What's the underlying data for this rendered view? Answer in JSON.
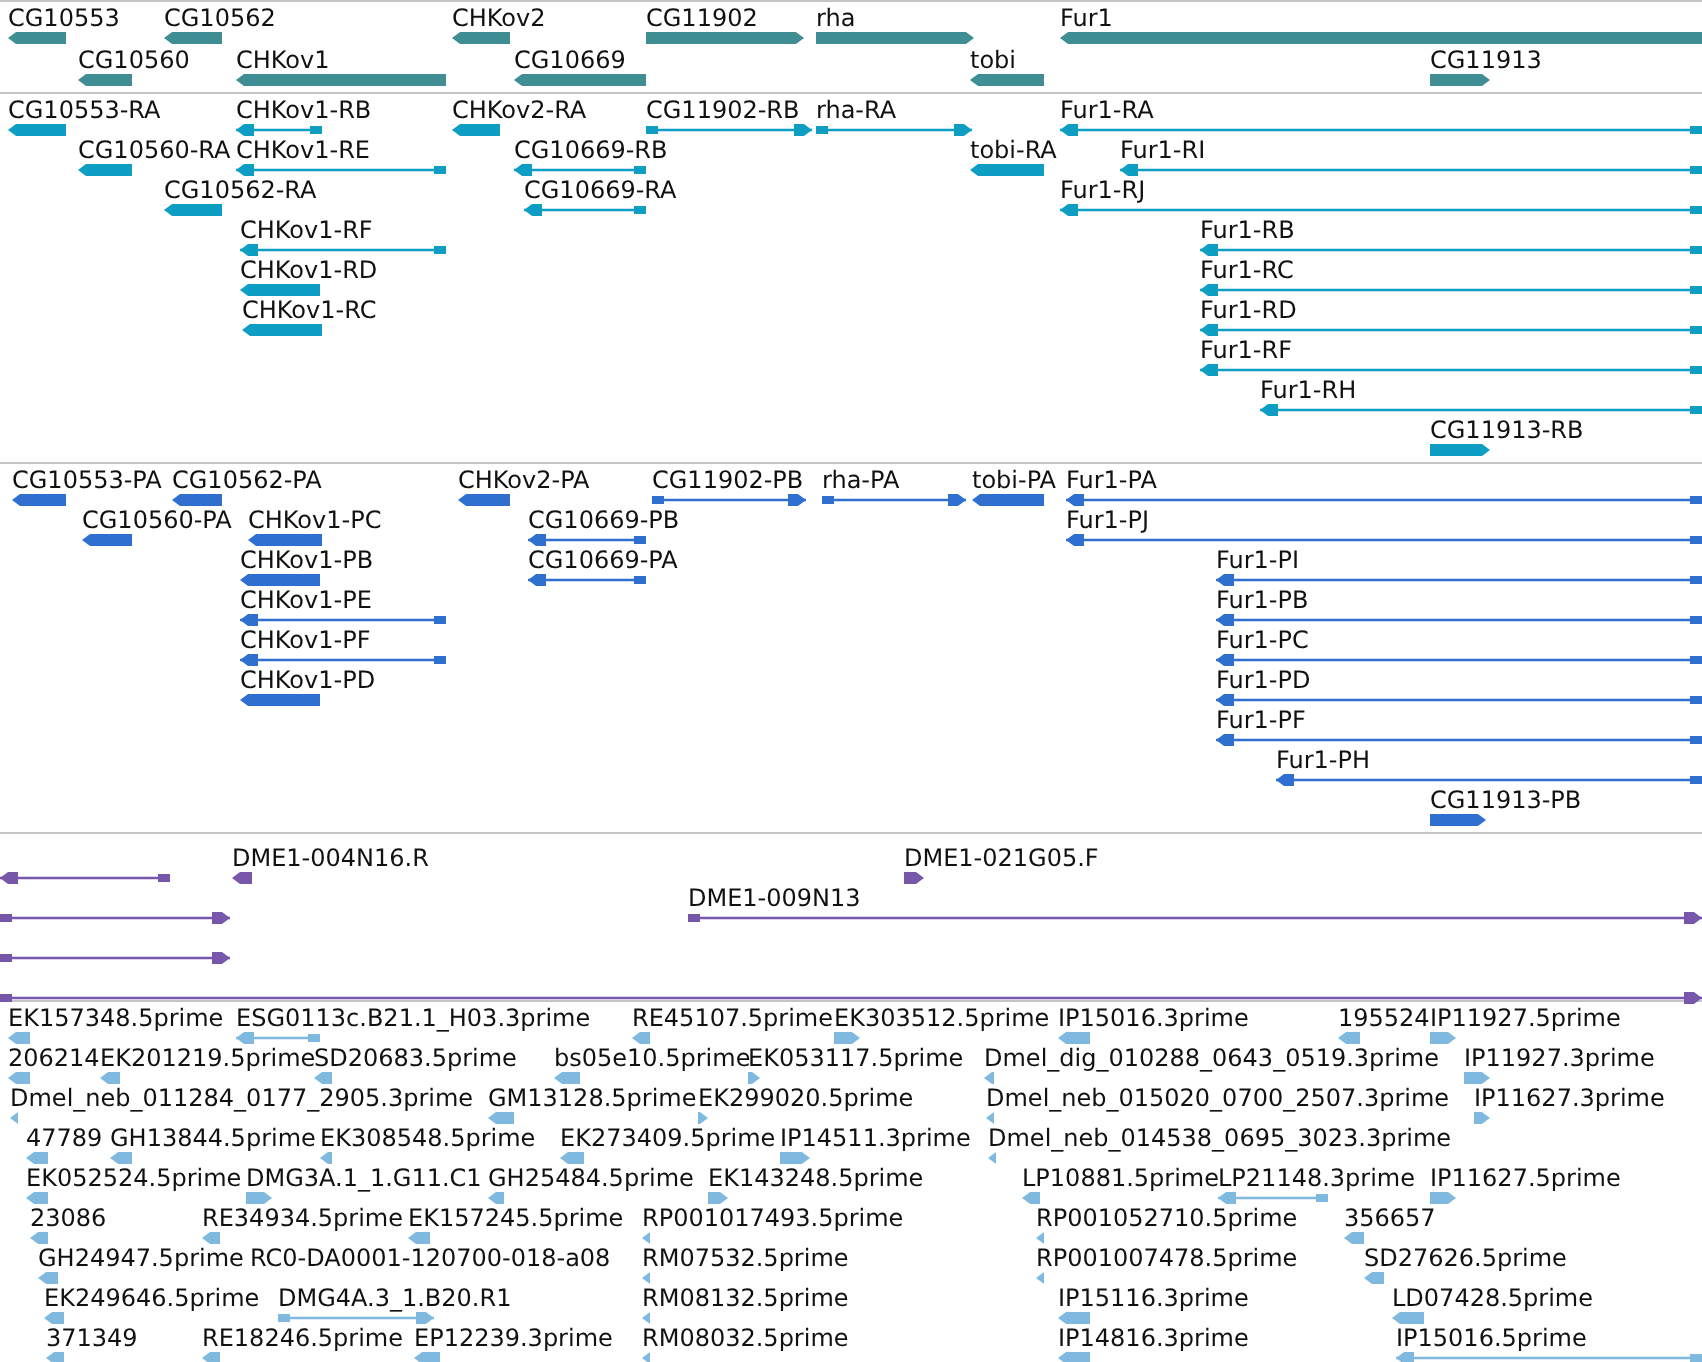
{
  "tracks": [
    {
      "kind": "gene",
      "features": [
        {
          "label": "CG10553",
          "reverse": true
        },
        {
          "label": "CG10562",
          "reverse": true
        },
        {
          "label": "CHKov2",
          "reverse": true
        },
        {
          "label": "CG11902",
          "reverse": false
        },
        {
          "label": "rha",
          "reverse": false
        },
        {
          "label": "Fur1",
          "reverse": true
        },
        {
          "label": "CG10560",
          "reverse": true
        },
        {
          "label": "CHKov1",
          "reverse": true
        },
        {
          "label": "CG10669",
          "reverse": true
        },
        {
          "label": "tobi",
          "reverse": true
        },
        {
          "label": "CG11913",
          "reverse": false
        }
      ]
    },
    {
      "kind": "transcript",
      "features": [
        {
          "label": "CG10553-RA",
          "reverse": true
        },
        {
          "label": "CHKov1-RB",
          "reverse": true
        },
        {
          "label": "CHKov2-RA",
          "reverse": true
        },
        {
          "label": "CG11902-RB",
          "reverse": false
        },
        {
          "label": "rha-RA",
          "reverse": false
        },
        {
          "label": "Fur1-RA",
          "reverse": true
        },
        {
          "label": "CG10560-RA",
          "reverse": true
        },
        {
          "label": "CHKov1-RE",
          "reverse": true
        },
        {
          "label": "CG10669-RB",
          "reverse": true
        },
        {
          "label": "tobi-RA",
          "reverse": true
        },
        {
          "label": "Fur1-RI",
          "reverse": true
        },
        {
          "label": "CG10562-RA",
          "reverse": true
        },
        {
          "label": "CG10669-RA",
          "reverse": true
        },
        {
          "label": "Fur1-RJ",
          "reverse": true
        },
        {
          "label": "CHKov1-RF",
          "reverse": true
        },
        {
          "label": "Fur1-RB",
          "reverse": true
        },
        {
          "label": "CHKov1-RD",
          "reverse": true
        },
        {
          "label": "Fur1-RC",
          "reverse": true
        },
        {
          "label": "CHKov1-RC",
          "reverse": true
        },
        {
          "label": "Fur1-RD",
          "reverse": true
        },
        {
          "label": "Fur1-RF",
          "reverse": true
        },
        {
          "label": "Fur1-RH",
          "reverse": true
        },
        {
          "label": "CG11913-RB",
          "reverse": false
        }
      ]
    },
    {
      "kind": "protein",
      "features": [
        {
          "label": "CG10553-PA",
          "reverse": true
        },
        {
          "label": "CG10562-PA",
          "reverse": true
        },
        {
          "label": "CHKov2-PA",
          "reverse": true
        },
        {
          "label": "CG11902-PB",
          "reverse": false
        },
        {
          "label": "rha-PA",
          "reverse": false
        },
        {
          "label": "tobi-PA",
          "reverse": true
        },
        {
          "label": "Fur1-PA",
          "reverse": true
        },
        {
          "label": "CG10560-PA",
          "reverse": true
        },
        {
          "label": "CHKov1-PC",
          "reverse": true
        },
        {
          "label": "CG10669-PB",
          "reverse": true
        },
        {
          "label": "Fur1-PJ",
          "reverse": true
        },
        {
          "label": "CHKov1-PB",
          "reverse": true
        },
        {
          "label": "CG10669-PA",
          "reverse": true
        },
        {
          "label": "Fur1-PI",
          "reverse": true
        },
        {
          "label": "CHKov1-PE",
          "reverse": true
        },
        {
          "label": "Fur1-PB",
          "reverse": true
        },
        {
          "label": "CHKov1-PF",
          "reverse": true
        },
        {
          "label": "Fur1-PC",
          "reverse": true
        },
        {
          "label": "CHKov1-PD",
          "reverse": true
        },
        {
          "label": "Fur1-PD",
          "reverse": true
        },
        {
          "label": "Fur1-PF",
          "reverse": true
        },
        {
          "label": "Fur1-PH",
          "reverse": true
        },
        {
          "label": "CG11913-PB",
          "reverse": false
        }
      ]
    },
    {
      "kind": "clone",
      "features": [
        {
          "reverse": true
        },
        {
          "label": "DME1-004N16.R",
          "reverse": true
        },
        {
          "label": "DME1-021G05.F",
          "reverse": false
        },
        {
          "reverse": false
        },
        {
          "label": "DME1-009N13",
          "reverse": false
        },
        {
          "reverse": false
        },
        {
          "reverse": false
        }
      ]
    },
    {
      "kind": "est",
      "features": [
        {
          "label": "EK157348.5prime",
          "reverse": true
        },
        {
          "label": "ESG0113c.B21.1_H03.3prime",
          "reverse": true
        },
        {
          "label": "RE45107.5prime",
          "reverse": true
        },
        {
          "label": "EK303512.5prime",
          "reverse": false
        },
        {
          "label": "IP15016.3prime",
          "reverse": true
        },
        {
          "label": "195524",
          "reverse": true
        },
        {
          "label": "IP11927.5prime",
          "reverse": false
        },
        {
          "label": "206214",
          "reverse": true
        },
        {
          "label": "EK201219.5prime",
          "reverse": true
        },
        {
          "label": "SD20683.5prime",
          "reverse": true
        },
        {
          "label": "bs05e10.5prime",
          "reverse": true
        },
        {
          "label": "EK053117.5prime",
          "reverse": false
        },
        {
          "label": "Dmel_dig_010288_0643_0519.3prime",
          "reverse": true
        },
        {
          "label": "IP11927.3prime",
          "reverse": false
        },
        {
          "label": "Dmel_neb_011284_0177_2905.3prime",
          "reverse": true
        },
        {
          "label": "GM13128.5prime",
          "reverse": true
        },
        {
          "label": "EK299020.5prime",
          "reverse": false
        },
        {
          "label": "Dmel_neb_015020_0700_2507.3prime",
          "reverse": true
        },
        {
          "label": "IP11627.3prime",
          "reverse": false
        },
        {
          "label": "47789",
          "reverse": true
        },
        {
          "label": "GH13844.5prime",
          "reverse": true
        },
        {
          "label": "EK308548.5prime",
          "reverse": true
        },
        {
          "label": "EK273409.5prime",
          "reverse": true
        },
        {
          "label": "IP14511.3prime",
          "reverse": false
        },
        {
          "label": "Dmel_neb_014538_0695_3023.3prime",
          "reverse": true
        },
        {
          "label": "EK052524.5prime",
          "reverse": true
        },
        {
          "label": "DMG3A.1_1.G11.C1",
          "reverse": false
        },
        {
          "label": "GH25484.5prime",
          "reverse": true
        },
        {
          "label": "EK143248.5prime",
          "reverse": false
        },
        {
          "label": "LP10881.5prime",
          "reverse": true
        },
        {
          "label": "LP21148.3prime",
          "reverse": true
        },
        {
          "label": "IP11627.5prime",
          "reverse": false
        },
        {
          "label": "23086",
          "reverse": true
        },
        {
          "label": "RE34934.5prime",
          "reverse": true
        },
        {
          "label": "EK157245.5prime",
          "reverse": true
        },
        {
          "label": "RP001017493.5prime",
          "reverse": true
        },
        {
          "label": "RP001052710.5prime",
          "reverse": true
        },
        {
          "label": "356657",
          "reverse": true
        },
        {
          "label": "GH24947.5prime",
          "reverse": true
        },
        {
          "label": "RC0-DA0001-120700-018-a08"
        },
        {
          "label": "RM07532.5prime",
          "reverse": true
        },
        {
          "label": "RP001007478.5prime",
          "reverse": true
        },
        {
          "label": "SD27626.5prime",
          "reverse": true
        },
        {
          "label": "EK249646.5prime",
          "reverse": true
        },
        {
          "label": "DMG4A.3_1.B20.R1",
          "reverse": false
        },
        {
          "label": "RM08132.5prime",
          "reverse": true
        },
        {
          "label": "IP15116.3prime",
          "reverse": true
        },
        {
          "label": "LD07428.5prime",
          "reverse": true
        },
        {
          "label": "371349",
          "reverse": true
        },
        {
          "label": "RE18246.5prime",
          "reverse": true
        },
        {
          "label": "EP12239.3prime",
          "reverse": true
        },
        {
          "label": "RM08032.5prime",
          "reverse": true
        },
        {
          "label": "IP14816.3prime",
          "reverse": true
        },
        {
          "label": "IP15016.5prime",
          "reverse": true
        }
      ]
    }
  ]
}
